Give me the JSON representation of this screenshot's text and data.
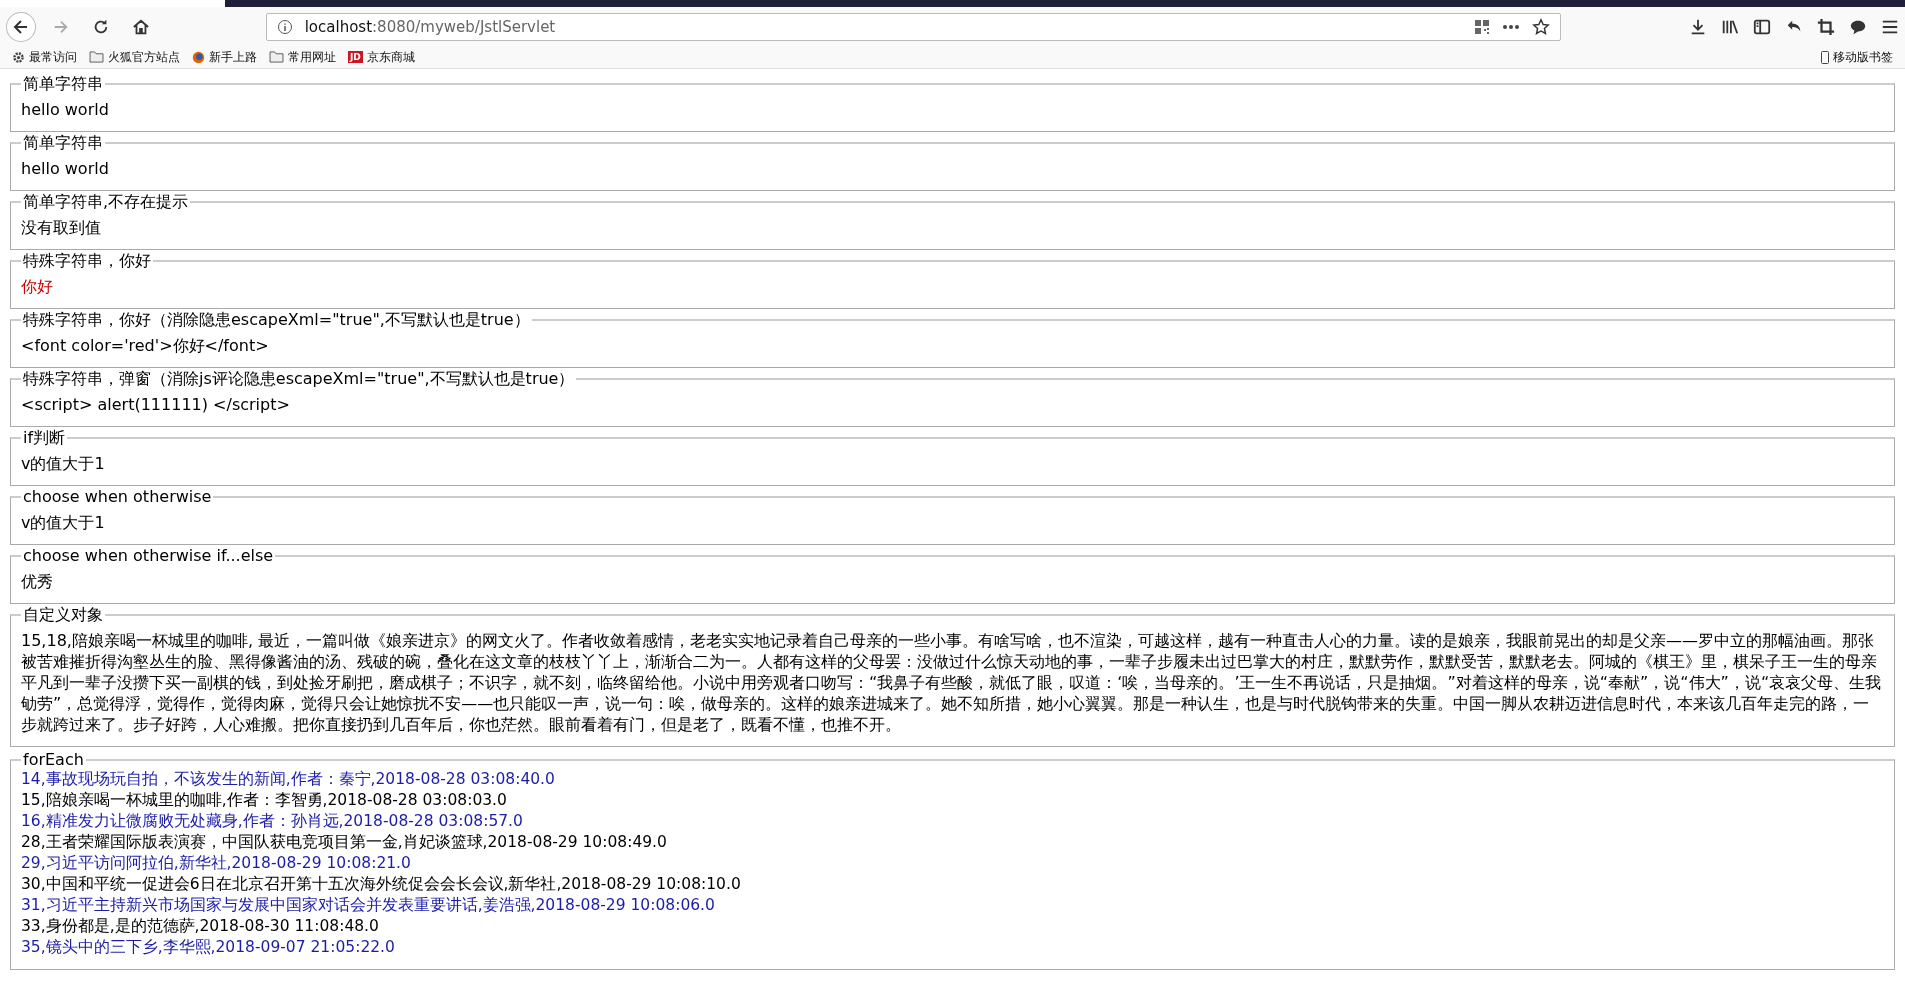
{
  "browser": {
    "url_host": "localhost",
    "url_path": ":8080/myweb/JstlServlet",
    "bookmarks": [
      {
        "kind": "gear",
        "label": "最常访问"
      },
      {
        "kind": "folder",
        "label": "火狐官方站点"
      },
      {
        "kind": "globe",
        "label": "新手上路"
      },
      {
        "kind": "folder",
        "label": "常用网址"
      },
      {
        "kind": "jd",
        "badge": "JD",
        "label": "京东商城"
      }
    ],
    "mobile_bookmarks": "移动版书签"
  },
  "sections": [
    {
      "legend": "简单字符串",
      "value": "hello world",
      "color": "#000000"
    },
    {
      "legend": "简单字符串",
      "value": "hello world",
      "color": "#000000"
    },
    {
      "legend": "简单字符串,不存在提示",
      "value": "没有取到值",
      "color": "#000000"
    },
    {
      "legend": "特殊字符串，你好",
      "value": "你好",
      "color": "#cc0000"
    },
    {
      "legend": "特殊字符串，你好（消除隐患escapeXml=\"true\",不写默认也是true）",
      "value": "<font color='red'>你好</font>",
      "color": "#000000"
    },
    {
      "legend": "特殊字符串，弹窗（消除js评论隐患escapeXml=\"true\",不写默认也是true）",
      "value": "<script> alert(111111) </script>",
      "color": "#000000"
    },
    {
      "legend": "if判断",
      "value": "v的值大于1",
      "color": "#000000"
    },
    {
      "legend": "choose when otherwise",
      "value": "v的值大于1",
      "color": "#000000"
    },
    {
      "legend": "choose when otherwise if...else",
      "value": "优秀",
      "color": "#000000"
    },
    {
      "legend": "自定义对象",
      "value": "15,18,陪娘亲喝一杯城里的咖啡, 最近，一篇叫做《娘亲进京》的网文火了。作者收敛着感情，老老实实地记录着自己母亲的一些小事。有啥写啥，也不渲染，可越这样，越有一种直击人心的力量。读的是娘亲，我眼前晃出的却是父亲——罗中立的那幅油画。那张被苦难摧折得沟壑丛生的脸、黑得像酱油的汤、残破的碗，叠化在这文章的枝枝丫丫上，渐渐合二为一。人都有这样的父母罢：没做过什么惊天动地的事，一辈子步履未出过巴掌大的村庄，默默劳作，默默受苦，默默老去。阿城的《棋王》里，棋呆子王一生的母亲平凡到一辈子没攒下买一副棋的钱，到处捡牙刷把，磨成棋子；不识字，就不刻，临终留给他。小说中用旁观者口吻写：“我鼻子有些酸，就低了眼，叹道：‘唉，当母亲的。’王一生不再说话，只是抽烟。”对着这样的母亲，说“奉献”，说“伟大”，说“哀哀父母、生我劬劳”，总觉得浮，觉得作，觉得肉麻，觉得只会让她惊扰不安——也只能叹一声，说一句：唉，做母亲的。这样的娘亲进城来了。她不知所措，她小心翼翼。那是一种认生，也是与时代脱钩带来的失重。中国一脚从农耕迈进信息时代，本来该几百年走完的路，一步就跨过来了。步子好跨，人心难搬。把你直接扔到几百年后，你也茫然。眼前看着有门，但是老了，既看不懂，也推不开。",
      "color": "#000000"
    }
  ],
  "foreach": {
    "legend": "forEach",
    "rows": [
      {
        "text": "14,事故现场玩自拍，不该发生的新闻,作者：秦宁,2018-08-28 03:08:40.0",
        "color": "#1c1ca8"
      },
      {
        "text": "15,陪娘亲喝一杯城里的咖啡,作者：李智勇,2018-08-28 03:08:03.0",
        "color": "#000000"
      },
      {
        "text": "16,精准发力让微腐败无处藏身,作者：孙肖远,2018-08-28 03:08:57.0",
        "color": "#1c1ca8"
      },
      {
        "text": "28,王者荣耀国际版表演赛，中国队获电竞项目第一金,肖妃谈篮球,2018-08-29 10:08:49.0",
        "color": "#000000"
      },
      {
        "text": "29,习近平访问阿拉伯,新华社,2018-08-29 10:08:21.0",
        "color": "#1c1ca8"
      },
      {
        "text": "30,中国和平统一促进会6日在北京召开第十五次海外统促会会长会议,新华社,2018-08-29 10:08:10.0",
        "color": "#000000"
      },
      {
        "text": "31,习近平主持新兴市场国家与发展中国家对话会并发表重要讲话,姜浩强,2018-08-29 10:08:06.0",
        "color": "#1c1ca8"
      },
      {
        "text": "33,身份都是,是的范德萨,2018-08-30 11:08:48.0",
        "color": "#000000"
      },
      {
        "text": "35,镜头中的三下乡,李华熙,2018-09-07 21:05:22.0",
        "color": "#1c1ca8"
      }
    ]
  }
}
